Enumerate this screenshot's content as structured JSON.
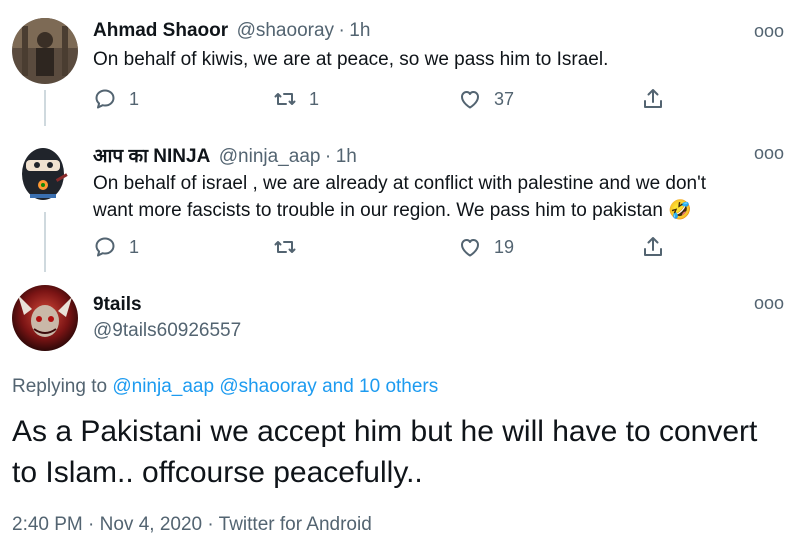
{
  "tweet1": {
    "name": "Ahmad Shaoor",
    "handle": "@shaooray",
    "dot": "·",
    "time": "1h",
    "text": "On behalf of kiwis, we are at peace, so we pass him to Israel.",
    "replies": "1",
    "retweets": "1",
    "likes": "37",
    "more": "ooo"
  },
  "tweet2": {
    "name": "आप का NINJA",
    "handle": "@ninja_aap",
    "dot": "·",
    "time": "1h",
    "text_line1": "On behalf of israel , we are already at conflict with palestine and we don't",
    "text_line2": "want more fascists to trouble in our region. We pass him to pakistan",
    "emoji": "🤣",
    "replies": "1",
    "likes": "19",
    "more": "ooo"
  },
  "main_tweet": {
    "name": "9tails",
    "handle": "@9tails60926557",
    "more": "ooo",
    "replying_prefix": "Replying to",
    "replying_to_1": "@ninja_aap",
    "replying_to_2": "@shaooray",
    "replying_to_3": "and 10 others",
    "text_line1": "As a Pakistani we accept him but he will have to convert",
    "text_line2": "to Islam.. offcourse peacefully..",
    "timestamp": "2:40 PM · Nov 4, 2020 · Twitter for Android"
  },
  "icons": {
    "reply": "reply-icon",
    "retweet": "retweet-icon",
    "like": "heart-icon",
    "share": "share-icon",
    "more": "more-icon"
  },
  "colors": {
    "link": "#1d9bf0",
    "secondary": "#536471",
    "thread_line": "#cfd9de"
  }
}
